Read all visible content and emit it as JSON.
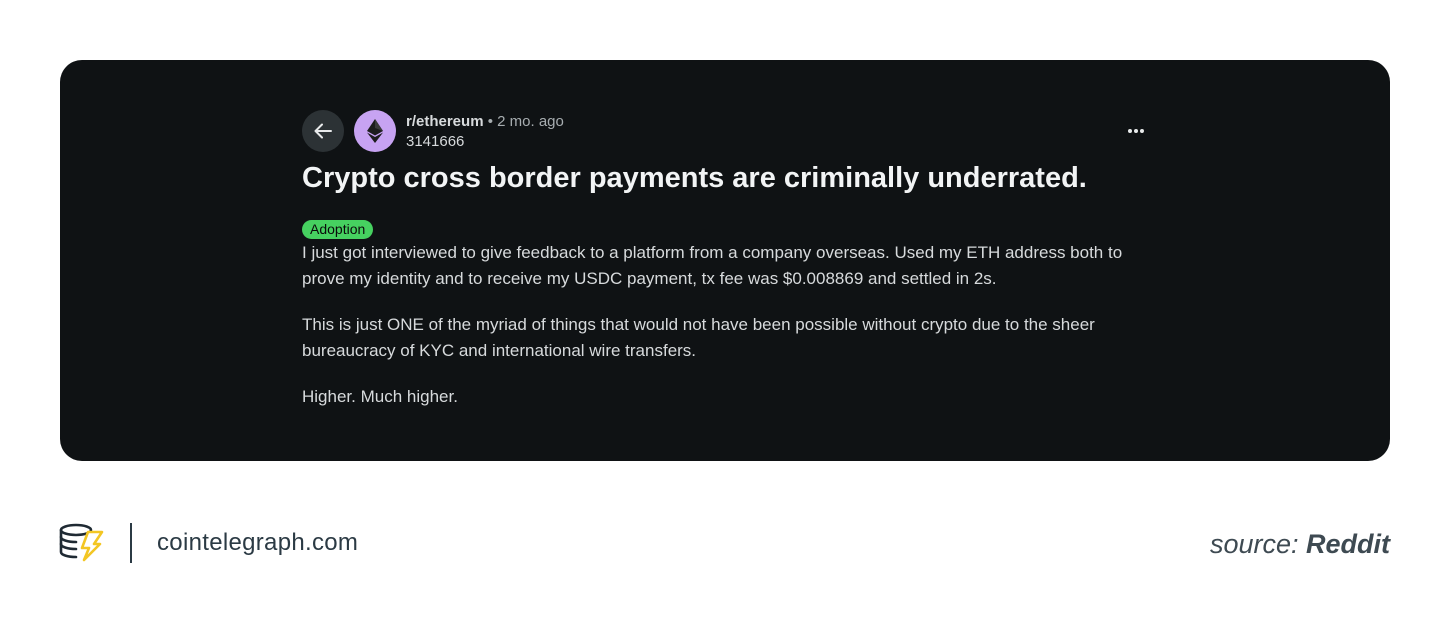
{
  "post": {
    "subreddit": "r/ethereum",
    "separator": "•",
    "time_ago": "2 mo. ago",
    "author": "3141666",
    "title": "Crypto cross border payments are criminally underrated.",
    "flair": "Adoption",
    "paragraphs": [
      "I just got interviewed to give feedback to a platform from a company overseas. Used my ETH address both to prove my identity and to receive my USDC payment, tx fee was $0.008869 and settled in 2s.",
      "This is just ONE of the myriad of things that would not have been possible without crypto due to the sheer bureaucracy of KYC and international wire transfers.",
      "Higher. Much higher."
    ],
    "icons": {
      "back": "arrow-left-icon",
      "avatar": "ethereum-icon",
      "more": "ellipsis-icon"
    }
  },
  "footer": {
    "domain": "cointelegraph.com",
    "source_label": "source:",
    "source_name": "Reddit",
    "logo_icon": "cointelegraph-logo-icon"
  },
  "colors": {
    "card_bg": "#0f1214",
    "flair_bg": "#46d160",
    "avatar_bg": "#c7a3f2",
    "logo_accent": "#f3c623"
  }
}
